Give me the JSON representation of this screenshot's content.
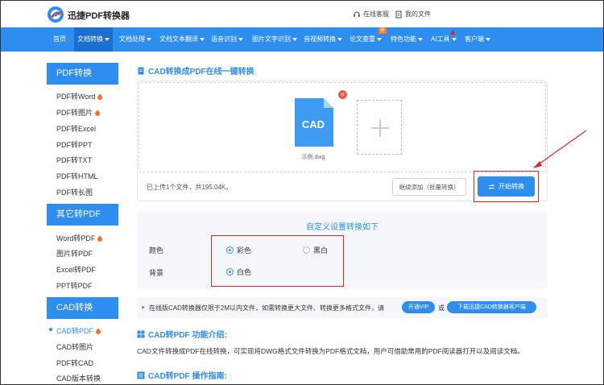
{
  "header": {
    "brand": "迅捷PDF转换器",
    "support": "在线客服",
    "files": "我的文件"
  },
  "nav": {
    "items": [
      "首页",
      "文档转换",
      "文档处理",
      "文档文本翻译",
      "语音识别",
      "图片文字识别",
      "音视频转换",
      "论文查重",
      "特色功能",
      "AI工具",
      "客户端"
    ],
    "new_badge": "新"
  },
  "sidebar": {
    "groups": [
      {
        "title": "PDF转换",
        "items": [
          "PDF转Word",
          "PDF转图片",
          "PDF转Excel",
          "PDF转PPT",
          "PDF转TXT",
          "PDF转HTML",
          "PDF转长图"
        ]
      },
      {
        "title": "其它转PDF",
        "items": [
          "Word转PDF",
          "图片转PDF",
          "Excel转PDF",
          "PPT转PDF"
        ]
      },
      {
        "title": "CAD转换",
        "items": [
          "CAD转PDF",
          "CAD转图片",
          "PDF转CAD",
          "CAD版本转换"
        ]
      }
    ]
  },
  "main": {
    "title": "CAD转换成PDF在线一键转换",
    "file_label": "CAD",
    "file_name": "示例.dwg",
    "status": "已上传1个文件，共195.04K。",
    "continue_btn": "继续添加（批量转换）",
    "start_btn": "开始转换",
    "settings_title": "自定义设置转换如下",
    "color_label": "颜色",
    "color_opt1": "彩色",
    "color_opt2": "黑白",
    "bg_label": "背景",
    "bg_opt1": "白色",
    "note": "在线版CAD转换器仅限于2M以内文件，如需转换更大文件、转换更多格式文件，请",
    "vip_btn": "开通VIP",
    "or": "或",
    "download_btn": "下载迅捷CAD转换器客户端",
    "intro_title": "CAD转PDF 功能介绍:",
    "intro_text": "CAD文件转换成PDF在线转换，可实现将DWG格式文件转换为PDF格式文档，用户可借助常用的PDF阅读器打开以及阅读文档。",
    "guide_title": "CAD转PDF 操作指南:"
  },
  "colors": {
    "accent": "#2e8ef0",
    "highlight": "#d62c2c",
    "fire": "#ff6a2a"
  }
}
